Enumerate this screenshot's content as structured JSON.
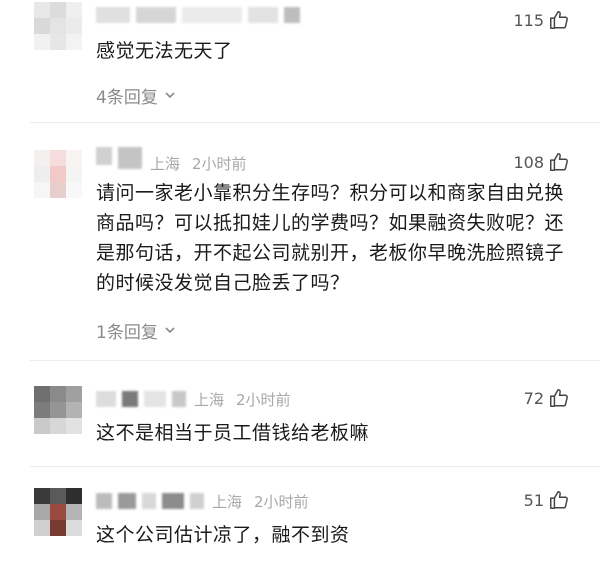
{
  "comments": [
    {
      "text": "感觉无法无天了",
      "likes": "115",
      "replies": "4条回复",
      "location": "",
      "time": ""
    },
    {
      "text": "请问一家老小靠积分生存吗？积分可以和商家自由兑换商品吗？可以抵扣娃儿的学费吗？如果融资失败呢？还是那句话，开不起公司就别开，老板你早晚洗脸照镜子的时候没发觉自己脸丢了吗？",
      "likes": "108",
      "replies": "1条回复",
      "location": "上海",
      "time": "2小时前"
    },
    {
      "text": "这不是相当于员工借钱给老板嘛",
      "likes": "72",
      "location": "上海",
      "time": "2小时前"
    },
    {
      "text": "这个公司估计凉了，融不到资",
      "likes": "51",
      "location": "上海",
      "time": "2小时前"
    }
  ],
  "colors": {
    "text": "#1a1a1a",
    "meta": "#a8a8a8",
    "reply": "#8a8a8a",
    "divider": "#ececec"
  },
  "icons": [
    "thumb-up-icon",
    "chevron-down-icon"
  ]
}
